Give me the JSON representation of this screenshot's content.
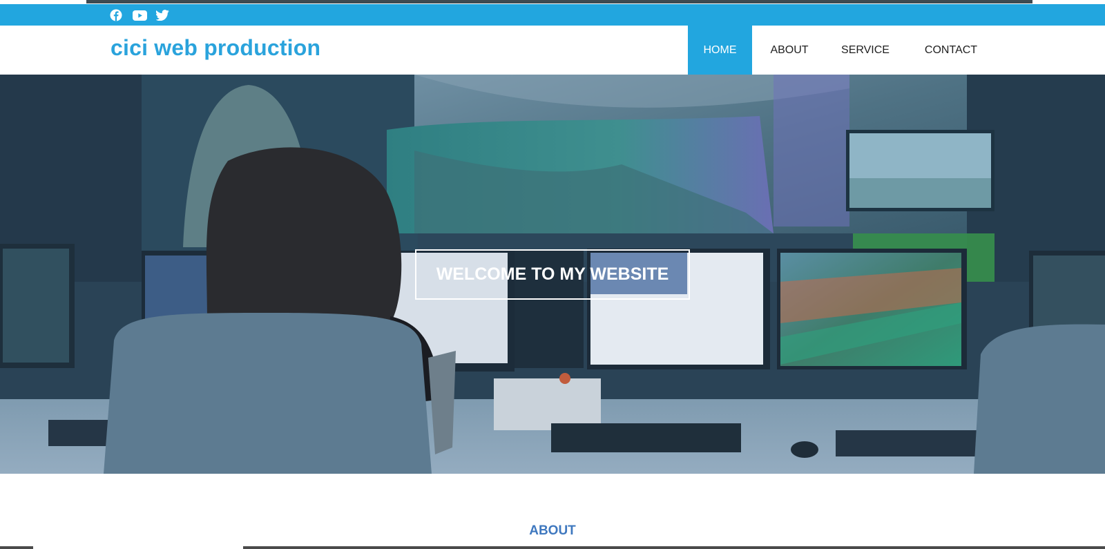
{
  "social": {
    "icons": [
      "facebook-icon",
      "youtube-icon",
      "twitter-icon"
    ]
  },
  "header": {
    "brand": "cici web production"
  },
  "nav": {
    "items": [
      {
        "label": "HOME",
        "active": true
      },
      {
        "label": "ABOUT",
        "active": false
      },
      {
        "label": "SERVICE",
        "active": false
      },
      {
        "label": "CONTACT",
        "active": false
      }
    ]
  },
  "hero": {
    "welcome": "WELCOME TO MY WEBSITE"
  },
  "about": {
    "heading": "ABOUT"
  },
  "colors": {
    "accent": "#22a6df",
    "brand": "#2aa3dc",
    "about_heading": "#3f78bf"
  }
}
